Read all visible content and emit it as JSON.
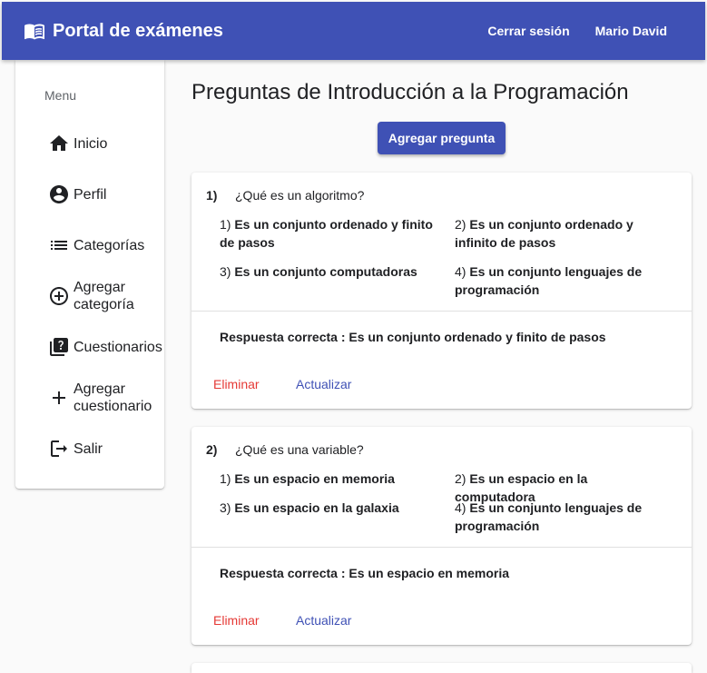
{
  "header": {
    "brand_title": "Portal de exámenes",
    "logout_label": "Cerrar sesión",
    "user_label": "Mario David"
  },
  "sidebar": {
    "menu_label": "Menu",
    "items": [
      {
        "label": "Inicio",
        "icon": "home-icon"
      },
      {
        "label": "Perfil",
        "icon": "account-circle-icon"
      },
      {
        "label": "Categorías",
        "icon": "list-icon"
      },
      {
        "label": "Agregar categoría",
        "icon": "add-circle-outline-icon"
      },
      {
        "label": "Cuestionarios",
        "icon": "quiz-icon"
      },
      {
        "label": "Agregar cuestionario",
        "icon": "add-icon"
      },
      {
        "label": "Salir",
        "icon": "logout-icon"
      }
    ]
  },
  "main": {
    "title": "Preguntas de Introducción a la Programación",
    "add_button_label": "Agregar pregunta",
    "delete_label": "Eliminar",
    "update_label": "Actualizar",
    "correct_prefix": "Respuesta correcta : ",
    "questions": [
      {
        "number": "1)",
        "text": "¿Qué es un algoritmo?",
        "options": [
          {
            "n": "1) ",
            "text": "Es un conjunto ordenado y finito de pasos"
          },
          {
            "n": "2) ",
            "text": "Es un conjunto ordenado y infinito de pasos"
          },
          {
            "n": "3) ",
            "text": "Es un conjunto computadoras"
          },
          {
            "n": "4) ",
            "text": "Es un conjunto lenguajes de programación"
          }
        ],
        "correct": "Es un conjunto ordenado y finito de pasos"
      },
      {
        "number": "2)",
        "text": "¿Qué es una variable?",
        "options": [
          {
            "n": "1) ",
            "text": "Es un espacio en memoria"
          },
          {
            "n": "2) ",
            "text": "Es un espacio en la computadora"
          },
          {
            "n": "3) ",
            "text": "Es un espacio en la galaxia"
          },
          {
            "n": "4) ",
            "text": "Es un conjunto lenguajes de programación"
          }
        ],
        "correct": "Es un espacio en memoria"
      }
    ]
  },
  "colors": {
    "primary": "#3f51b5",
    "warn": "#e53935"
  }
}
